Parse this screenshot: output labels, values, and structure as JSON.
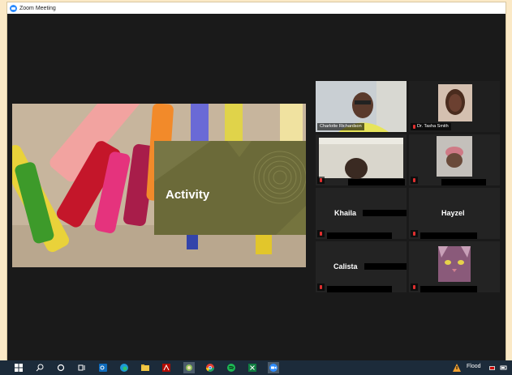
{
  "window": {
    "title": "Zoom Meeting"
  },
  "share": {
    "slide_title": "Activity"
  },
  "participants": [
    {
      "name": "Charlotte Richardson",
      "tile": "video",
      "active": true
    },
    {
      "name": "Dr. Tasha Smith",
      "tile": "video"
    },
    {
      "name": "",
      "tile": "video"
    },
    {
      "name": "",
      "tile": "video"
    },
    {
      "name": "Khaila",
      "tile": "name"
    },
    {
      "name": "Hayzel",
      "tile": "name"
    },
    {
      "name": "Calista",
      "tile": "name"
    },
    {
      "name": "",
      "tile": "video"
    }
  ],
  "taskbar": {
    "icons": [
      "windows-start-icon",
      "search-icon",
      "cortana-icon",
      "task-view-icon",
      "outlook-icon",
      "edge-icon",
      "file-explorer-icon",
      "acrobat-icon",
      "photos-icon",
      "chrome-icon",
      "spotify-icon",
      "excel-icon",
      "zoom-icon"
    ],
    "tray": {
      "weather_label": "Flood"
    }
  },
  "colors": {
    "active_speaker": "#b6e14a",
    "zoom_blue": "#2d8cff",
    "slide_card": "#6b6a39"
  }
}
